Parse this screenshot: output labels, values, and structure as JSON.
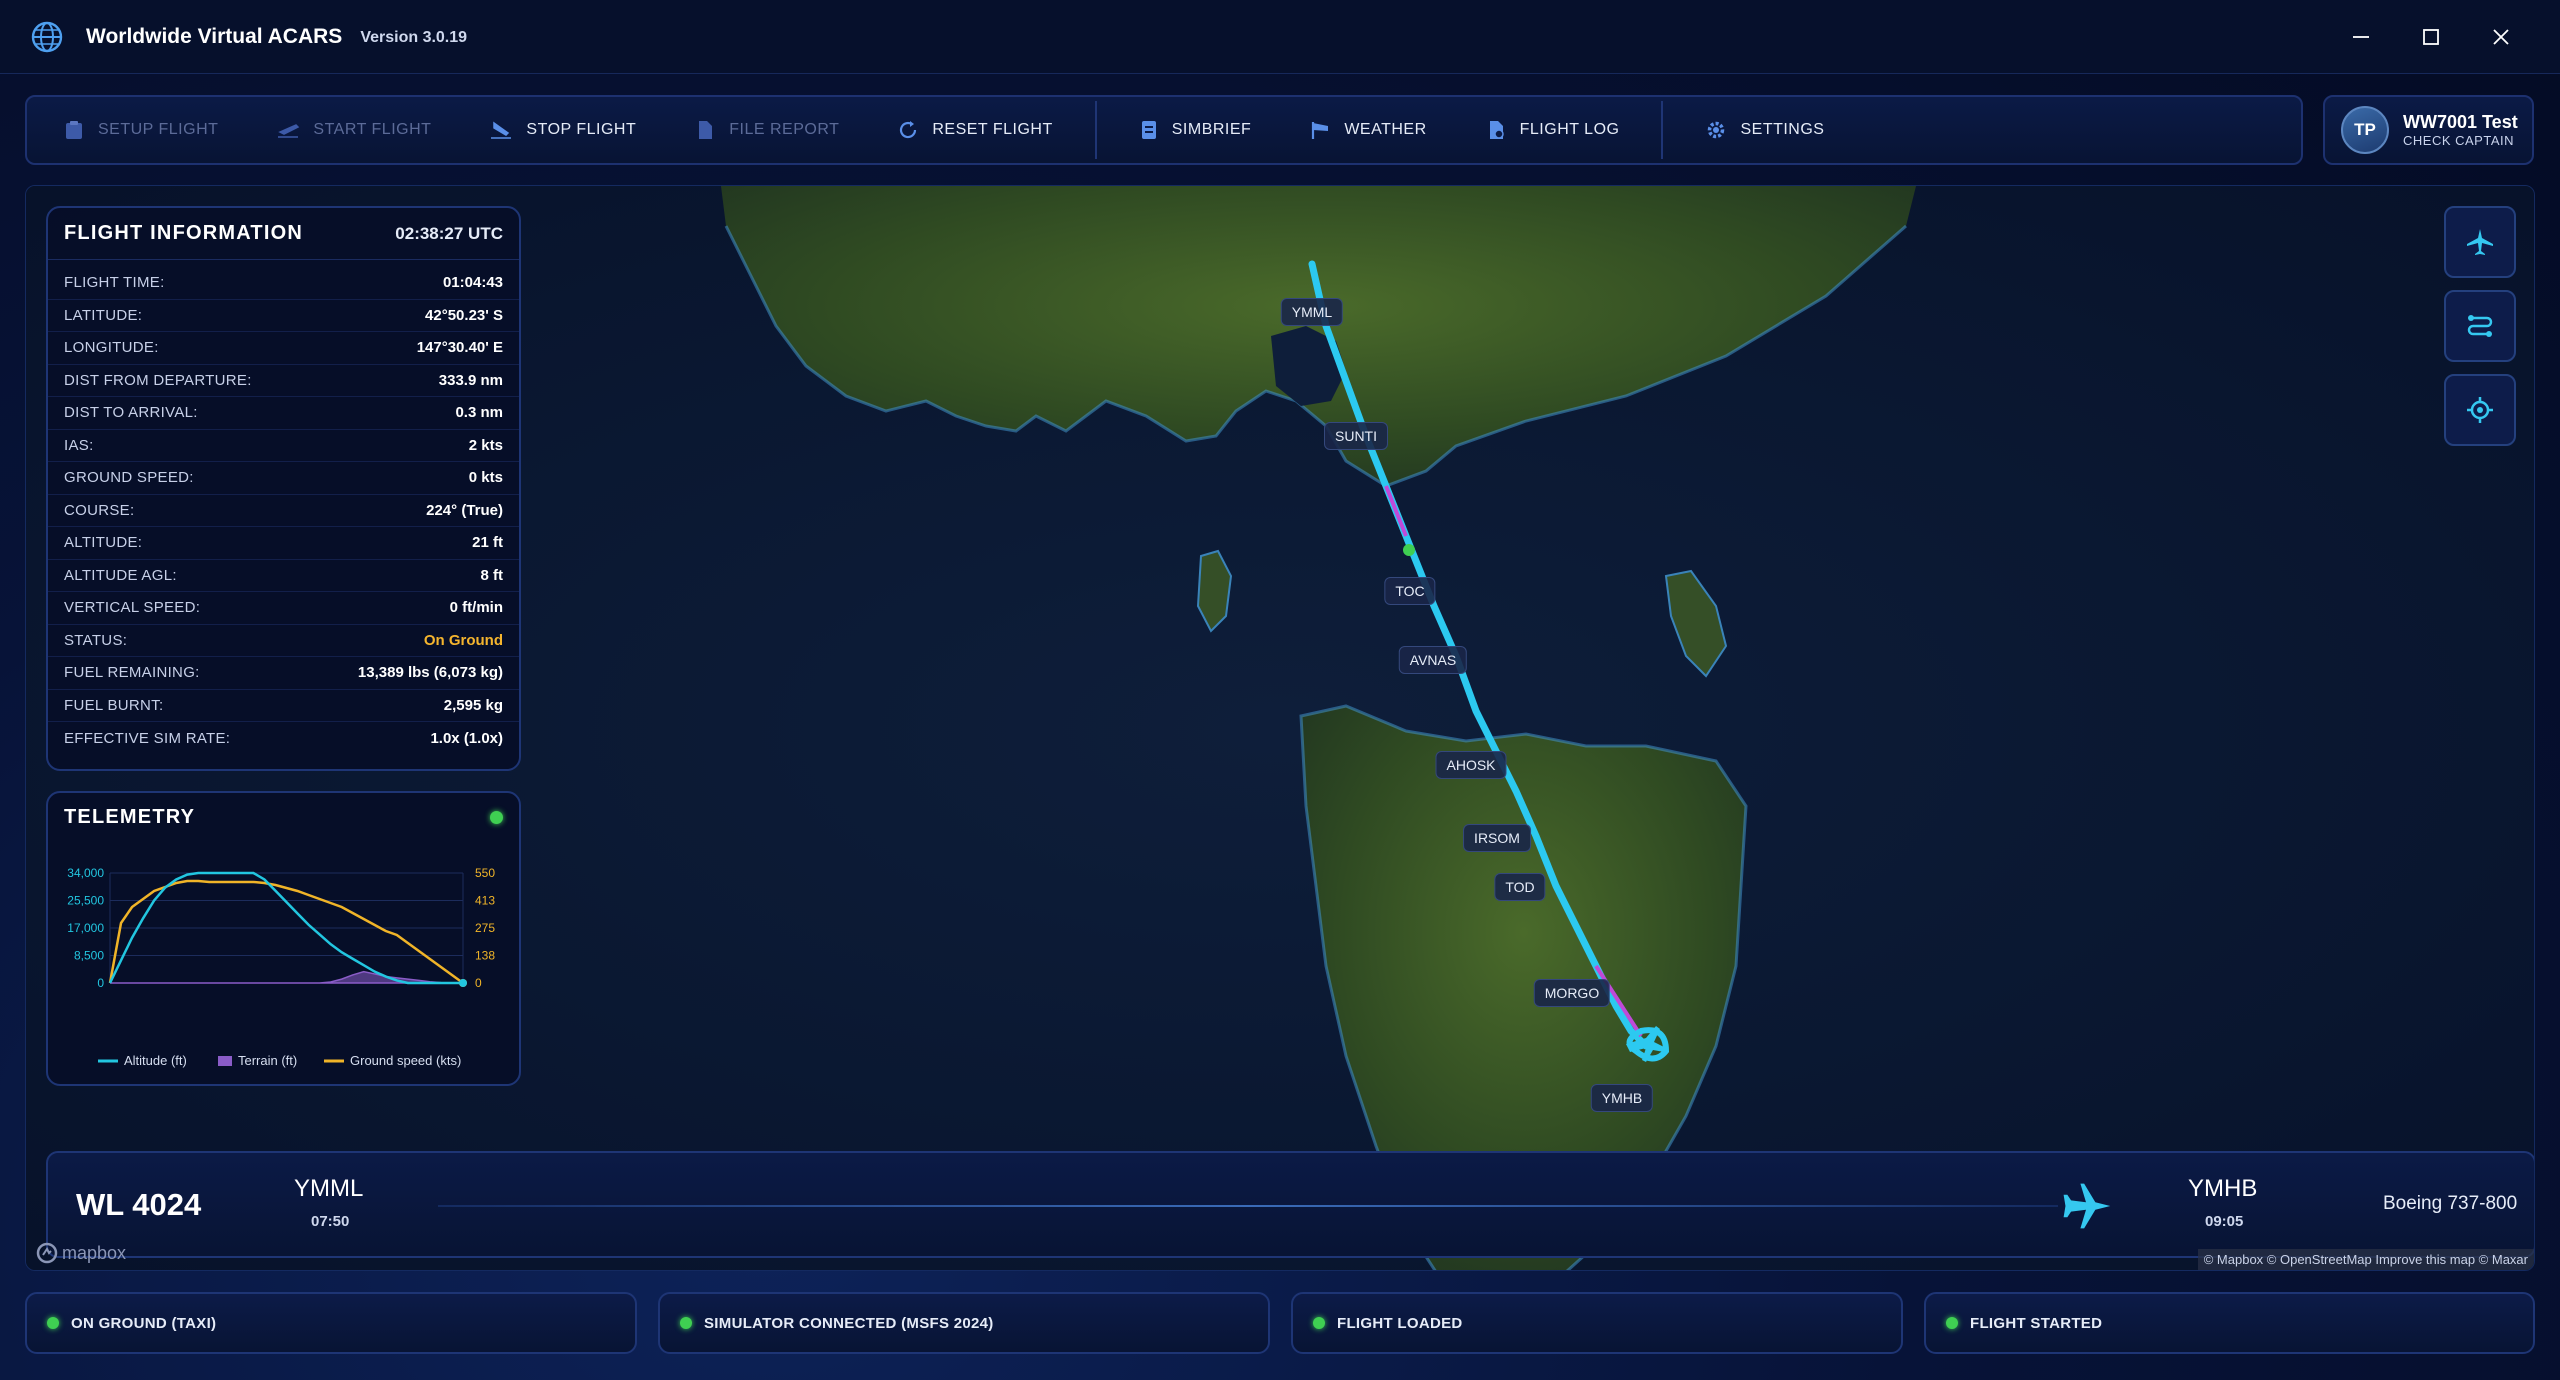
{
  "window": {
    "title": "Worldwide Virtual ACARS",
    "version": "Version 3.0.19"
  },
  "toolbar": {
    "items": [
      {
        "label": "SETUP FLIGHT",
        "enabled": false,
        "icon": "clipboard-icon"
      },
      {
        "label": "START FLIGHT",
        "enabled": false,
        "icon": "takeoff-icon"
      },
      {
        "label": "STOP FLIGHT",
        "enabled": true,
        "icon": "landing-icon"
      },
      {
        "label": "FILE REPORT",
        "enabled": false,
        "icon": "file-icon"
      },
      {
        "label": "RESET FLIGHT",
        "enabled": true,
        "icon": "reset-icon"
      },
      {
        "label": "SIMBRIEF",
        "enabled": true,
        "icon": "document-icon"
      },
      {
        "label": "WEATHER",
        "enabled": true,
        "icon": "windsock-icon"
      },
      {
        "label": "FLIGHT LOG",
        "enabled": true,
        "icon": "log-icon"
      },
      {
        "label": "SETTINGS",
        "enabled": true,
        "icon": "gear-icon"
      }
    ]
  },
  "user": {
    "initials": "TP",
    "name": "WW7001 Test",
    "rank": "CHECK CAPTAIN"
  },
  "flight_info": {
    "title": "FLIGHT INFORMATION",
    "time": "02:38:27 UTC",
    "rows": [
      {
        "label": "FLIGHT TIME:",
        "value": "01:04:43"
      },
      {
        "label": "LATITUDE:",
        "value": "42°50.23' S"
      },
      {
        "label": "LONGITUDE:",
        "value": "147°30.40' E"
      },
      {
        "label": "DIST FROM DEPARTURE:",
        "value": "333.9 nm"
      },
      {
        "label": "DIST TO ARRIVAL:",
        "value": "0.3 nm"
      },
      {
        "label": "IAS:",
        "value": "2 kts"
      },
      {
        "label": "GROUND SPEED:",
        "value": "0 kts"
      },
      {
        "label": "COURSE:",
        "value": "224° (True)"
      },
      {
        "label": "ALTITUDE:",
        "value": "21 ft"
      },
      {
        "label": "ALTITUDE AGL:",
        "value": "8 ft"
      },
      {
        "label": "VERTICAL SPEED:",
        "value": "0 ft/min"
      },
      {
        "label": "STATUS:",
        "value": "On Ground"
      },
      {
        "label": "FUEL REMAINING:",
        "value": "13,389 lbs (6,073 kg)"
      },
      {
        "label": "FUEL BURNT:",
        "value": "2,595 kg"
      },
      {
        "label": "EFFECTIVE SIM RATE:",
        "value": "1.0x (1.0x)"
      }
    ]
  },
  "telemetry": {
    "title": "TELEMETRY",
    "left_ticks": [
      "34,000",
      "25,500",
      "17,000",
      "8,500",
      "0"
    ],
    "right_ticks": [
      "550",
      "413",
      "275",
      "138",
      "0"
    ],
    "legend": [
      "Altitude (ft)",
      "Terrain (ft)",
      "Ground speed (kts)"
    ],
    "colors": {
      "altitude": "#22c6e0",
      "terrain": "#8a5cc8",
      "speed": "#f0b428"
    }
  },
  "chart_data": {
    "type": "line",
    "title": "",
    "x": [
      0,
      2,
      4,
      6,
      8,
      10,
      12,
      14,
      16,
      18,
      20,
      22,
      24,
      26,
      28,
      30,
      32,
      34,
      36,
      38,
      40,
      42,
      44,
      46,
      48,
      50,
      52,
      54,
      56,
      58,
      60,
      62,
      64
    ],
    "ylim_left": [
      0,
      34000
    ],
    "ylim_right": [
      0,
      550
    ],
    "series": [
      {
        "name": "Altitude (ft)",
        "axis": "left",
        "values": [
          0,
          7000,
          14000,
          20000,
          25500,
          29500,
          32000,
          33500,
          34000,
          34000,
          34000,
          34000,
          34000,
          34000,
          32000,
          28500,
          25000,
          21500,
          18000,
          15000,
          12000,
          9500,
          7500,
          5500,
          3500,
          2000,
          800,
          0,
          0,
          0,
          0,
          0,
          0
        ]
      },
      {
        "name": "Terrain (ft)",
        "axis": "left",
        "values": [
          0,
          0,
          0,
          0,
          0,
          0,
          0,
          0,
          0,
          0,
          0,
          0,
          0,
          0,
          0,
          0,
          0,
          0,
          0,
          0,
          300,
          1200,
          2500,
          3500,
          2800,
          2000,
          1600,
          1200,
          800,
          400,
          100,
          0,
          0
        ]
      },
      {
        "name": "Ground speed (kts)",
        "axis": "right",
        "values": [
          0,
          300,
          380,
          420,
          460,
          480,
          500,
          510,
          510,
          505,
          505,
          505,
          505,
          505,
          500,
          490,
          475,
          460,
          440,
          420,
          400,
          380,
          350,
          320,
          290,
          260,
          240,
          200,
          160,
          120,
          80,
          40,
          0
        ]
      }
    ]
  },
  "map": {
    "waypoints": [
      "YMML",
      "SUNTI",
      "TOC",
      "AVNAS",
      "AHOSK",
      "IRSOM",
      "TOD",
      "MORGO",
      "YMHB"
    ],
    "attribution": "© Mapbox © OpenStreetMap Improve this map © Maxar",
    "logo": "mapbox"
  },
  "flight": {
    "callsign": "WL 4024",
    "departure": "YMML",
    "departure_time": "07:50",
    "arrival": "YMHB",
    "arrival_time": "09:05",
    "aircraft": "Boeing 737-800"
  },
  "statusbar": [
    "ON GROUND (TAXI)",
    "SIMULATOR CONNECTED (MSFS 2024)",
    "FLIGHT LOADED",
    "FLIGHT STARTED"
  ]
}
